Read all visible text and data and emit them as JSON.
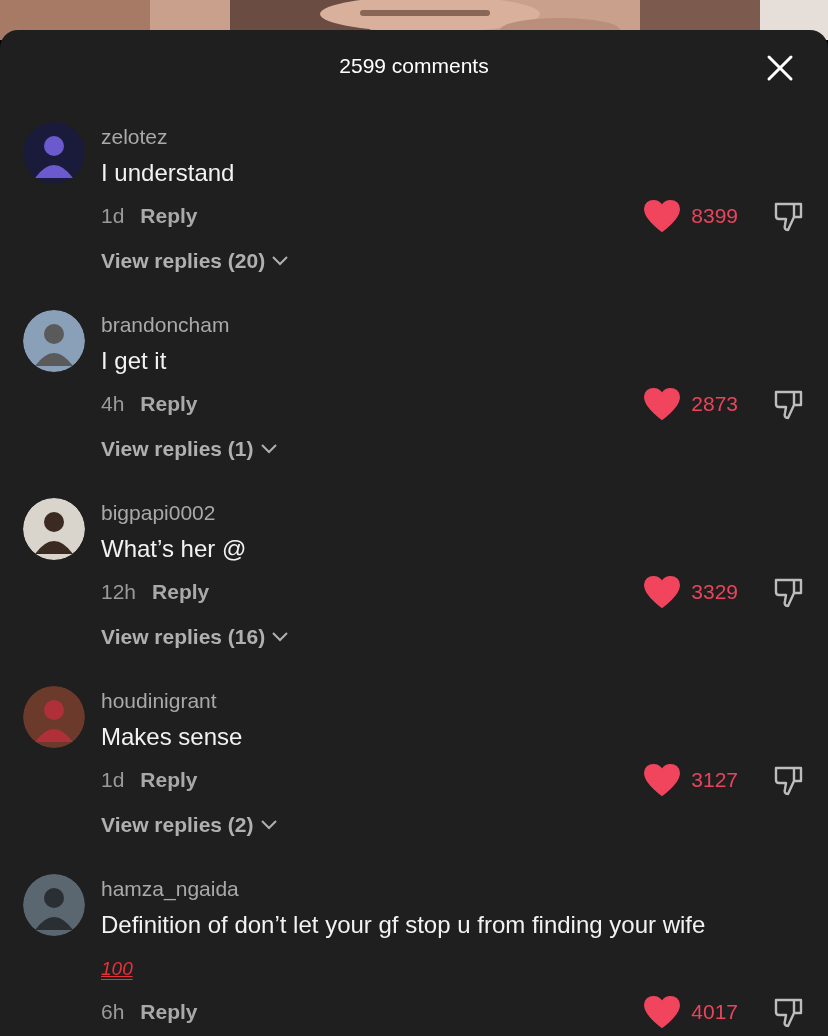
{
  "header": {
    "title": "2599 comments"
  },
  "comments": [
    {
      "username": "zelotez",
      "text": "I understand",
      "time": "1d",
      "reply": "Reply",
      "liked": true,
      "likes": "8399",
      "view_replies": "View replies (20)"
    },
    {
      "username": "brandoncham",
      "text": "I get it",
      "time": "4h",
      "reply": "Reply",
      "liked": true,
      "likes": "2873",
      "view_replies": "View replies (1)"
    },
    {
      "username": "bigpapi0002",
      "text": "What’s her @",
      "time": "12h",
      "reply": "Reply",
      "liked": true,
      "likes": "3329",
      "view_replies": "View replies (16)"
    },
    {
      "username": "houdinigrant",
      "text": "Makes sense",
      "time": "1d",
      "reply": "Reply",
      "liked": true,
      "likes": "3127",
      "view_replies": "View replies (2)"
    },
    {
      "username": "hamza_ngaida",
      "text": "Definition of don’t let your gf stop u from finding your wife",
      "emoji": "100",
      "time": "6h",
      "reply": "Reply",
      "liked": true,
      "likes": "4017"
    }
  ]
}
